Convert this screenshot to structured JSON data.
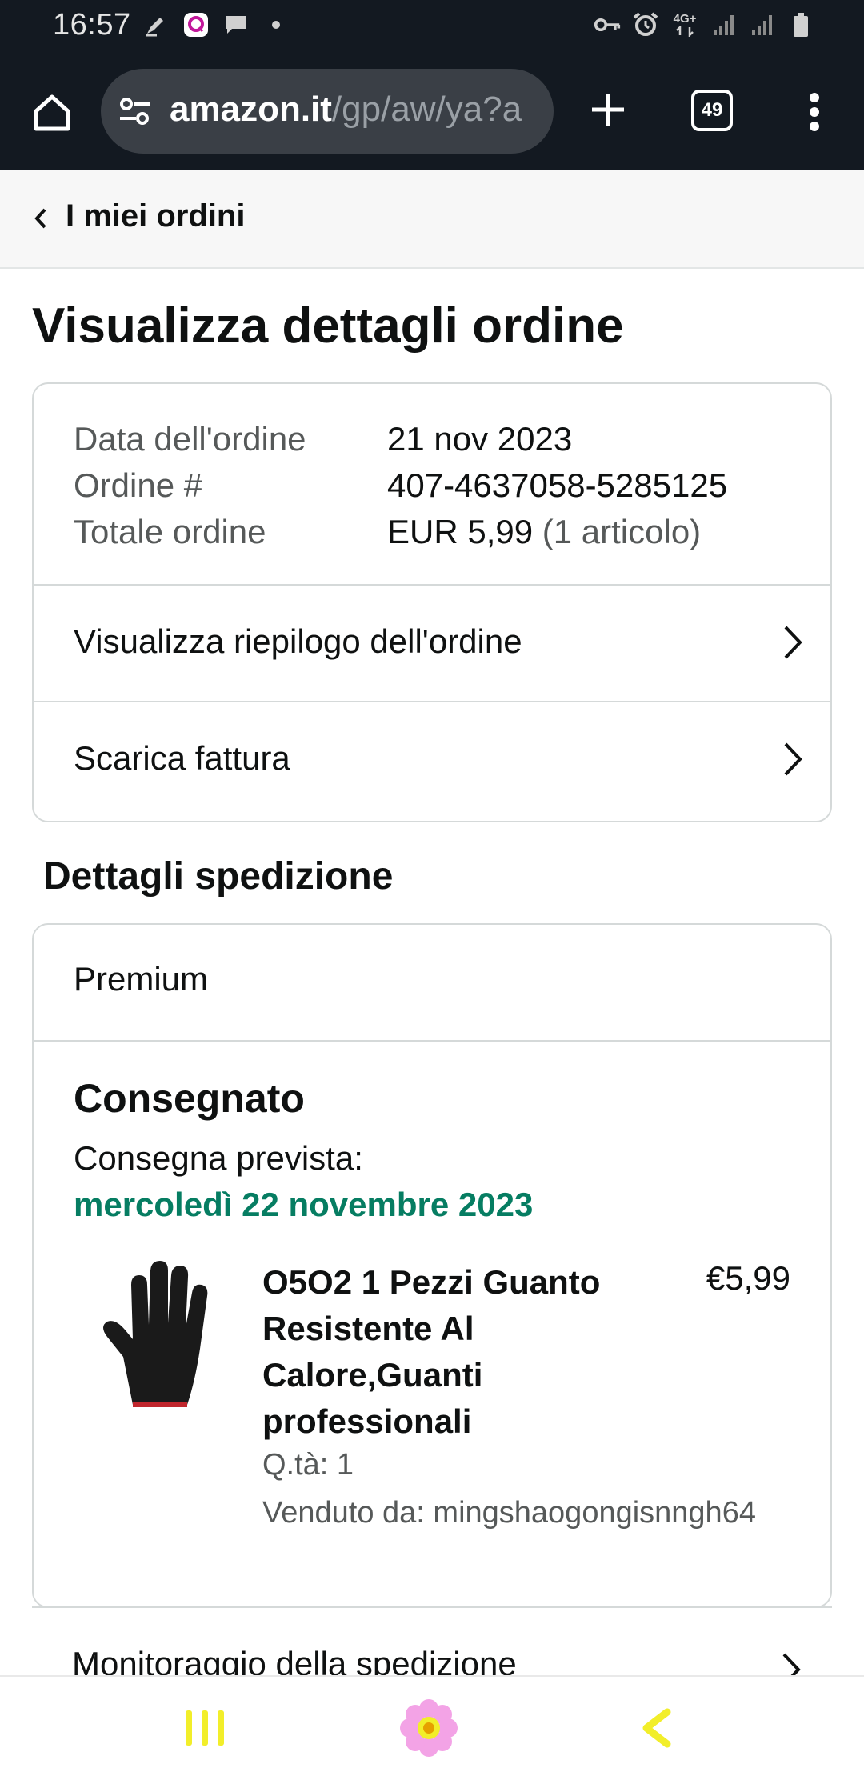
{
  "status_bar": {
    "time": "16:57",
    "left_icons": [
      "pen-notification-icon",
      "pink-app-icon",
      "message-icon",
      "dot-icon"
    ],
    "right_icons": [
      "vpn-key-icon",
      "alarm-icon",
      "network-4g-icon",
      "signal-icon",
      "signal-icon",
      "battery-icon"
    ],
    "network_label": "4G+"
  },
  "browser": {
    "url_domain": "amazon.it",
    "url_path": "/gp/aw/ya?a",
    "tab_count": "49"
  },
  "breadcrumb": {
    "label": "I miei ordini"
  },
  "page_title": "Visualizza dettagli ordine",
  "order_summary": {
    "rows": [
      {
        "label": "Data dell'ordine",
        "value": "21 nov 2023",
        "extra": ""
      },
      {
        "label": "Ordine #",
        "value": "407-4637058-5285125",
        "extra": ""
      },
      {
        "label": "Totale ordine",
        "value": "EUR 5,99",
        "extra": "(1 articolo)"
      }
    ],
    "links": [
      {
        "label": "Visualizza riepilogo dell'ordine"
      },
      {
        "label": "Scarica fattura"
      }
    ]
  },
  "shipping": {
    "section_title": "Dettagli spedizione",
    "method": "Premium",
    "status": "Consegnato",
    "delivery_label": "Consegna prevista:",
    "delivery_date": "mercoledì 22 novembre 2023",
    "delivery_date_color": "#067d62",
    "item": {
      "title": "O5O2 1 Pezzi Guanto Resistente Al Calore,Guanti professionali",
      "price": "€5,99",
      "qty": "Q.tà: 1",
      "seller": "Venduto da: mingshaogongisnngh64",
      "image": "black-glove-icon"
    },
    "track_label": "Monitoraggio della spedizione"
  },
  "nav": {
    "icons": [
      "recent-apps-icon",
      "home-flower-icon",
      "back-icon"
    ],
    "accent": "#f2ee2a"
  }
}
